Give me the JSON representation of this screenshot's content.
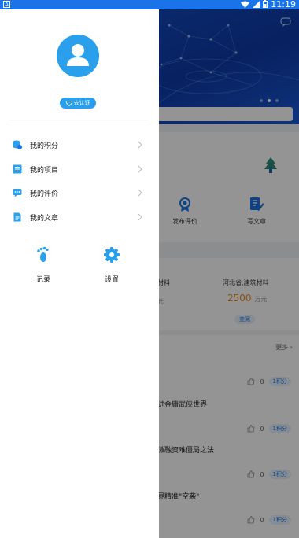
{
  "status_bar": {
    "time": "11:19",
    "left_badge": "A"
  },
  "background": {
    "tools": [
      {
        "label": "发布评价",
        "icon": "award-icon"
      },
      {
        "label": "写文章",
        "icon": "edit-icon"
      }
    ],
    "materials": [
      {
        "name": "材料",
        "price": "",
        "unit": "元"
      },
      {
        "name": "河北省,建筑材料",
        "price": "2500",
        "unit": "万元",
        "button": "查阅"
      }
    ],
    "more_label": "更多",
    "articles": [
      {
        "title": "",
        "likes": "0",
        "points": "1积分"
      },
      {
        "title": "进金庸武侠世界",
        "likes": "0",
        "points": "1积分"
      },
      {
        "title": "微融资难僵局之法",
        "likes": "0",
        "points": "1积分"
      },
      {
        "title": "界精准\"空袭\"！",
        "likes": "0",
        "points": "1积分"
      }
    ]
  },
  "drawer": {
    "badge_label": "去认证",
    "menu": [
      {
        "label": "我的积分",
        "icon": "points-icon"
      },
      {
        "label": "我的项目",
        "icon": "project-icon"
      },
      {
        "label": "我的评价",
        "icon": "comment-icon"
      },
      {
        "label": "我的文章",
        "icon": "article-icon"
      }
    ],
    "quick_actions": [
      {
        "label": "记录",
        "icon": "footprint-icon"
      },
      {
        "label": "设置",
        "icon": "gear-icon"
      }
    ]
  },
  "colors": {
    "accent": "#2aa0ec",
    "banner": "#1450c8",
    "price": "#f08a24"
  }
}
